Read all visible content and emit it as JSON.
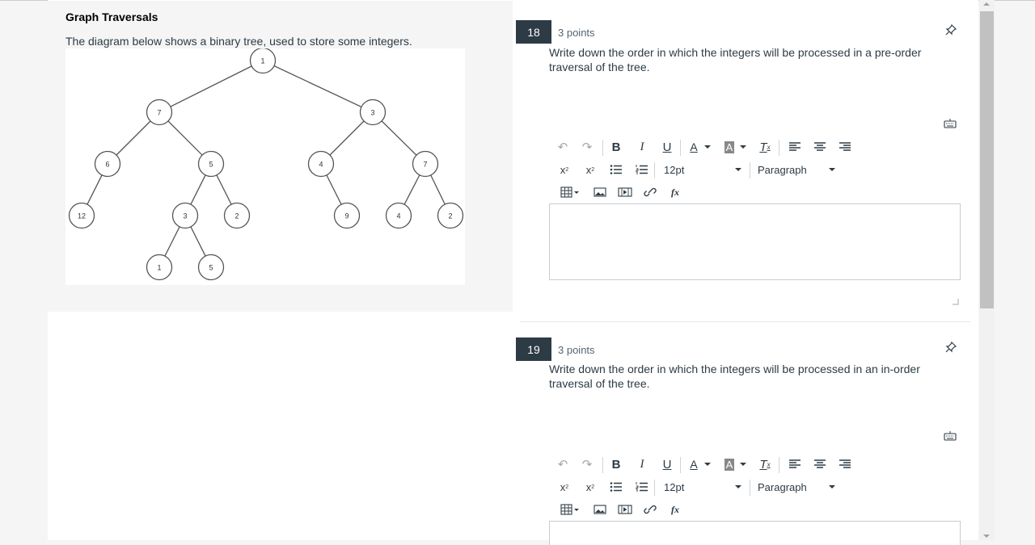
{
  "stimulus": {
    "title": "Graph Traversals",
    "text": "The diagram below shows a binary tree, used to store some integers.",
    "tree_nodes": [
      "1",
      "7",
      "3",
      "6",
      "5",
      "4",
      "7",
      "12",
      "3",
      "2",
      "9",
      "4",
      "2",
      "1",
      "5"
    ]
  },
  "questions": [
    {
      "number": "18",
      "points": "3 points",
      "text": "Write down the order in which the integers will be processed in a pre-order traversal of the tree.",
      "font_size": "12pt",
      "block_format": "Paragraph",
      "answer": ""
    },
    {
      "number": "19",
      "points": "3 points",
      "text": "Write down the order in which the integers will be processed in an in-order traversal of the tree.",
      "font_size": "12pt",
      "block_format": "Paragraph",
      "answer": ""
    }
  ],
  "toolbar_icons": [
    "undo-icon",
    "redo-icon",
    "bold-icon",
    "italic-icon",
    "underline-icon",
    "text-color-icon",
    "background-color-icon",
    "clear-formatting-icon",
    "align-left-icon",
    "align-center-icon",
    "align-right-icon",
    "superscript-icon",
    "subscript-icon",
    "bullet-list-icon",
    "numbered-list-icon",
    "table-icon",
    "image-icon",
    "media-icon",
    "link-icon",
    "equation-icon"
  ]
}
